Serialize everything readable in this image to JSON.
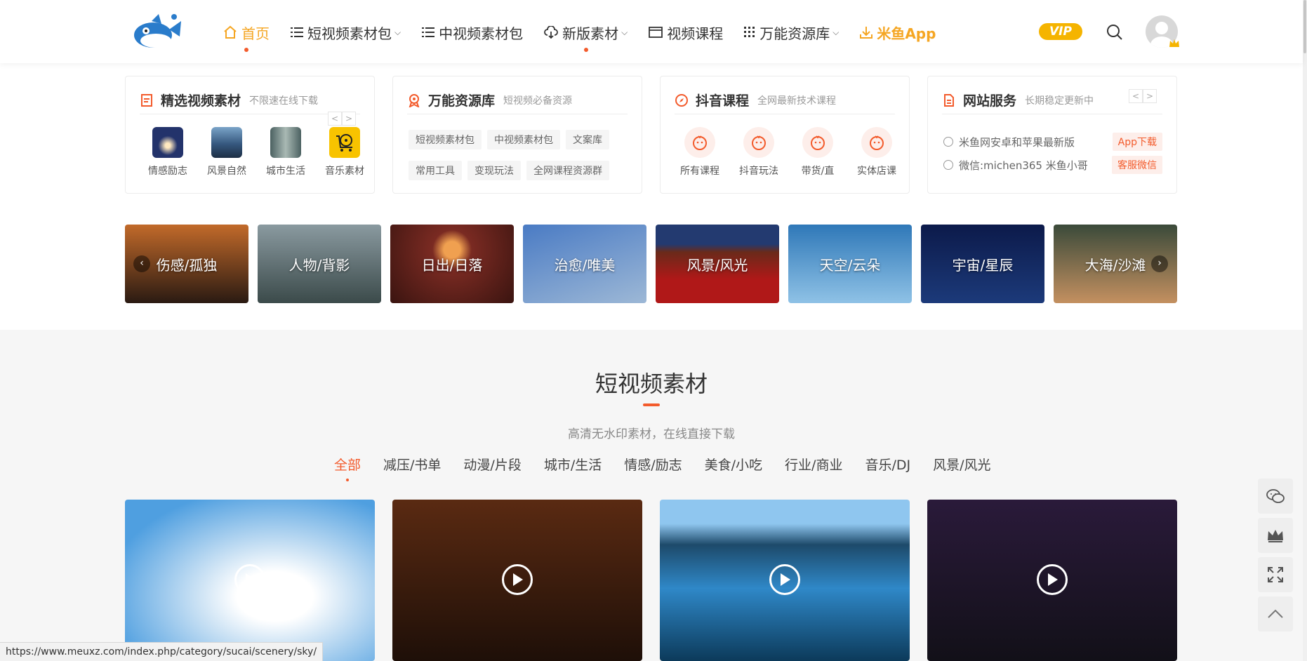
{
  "header": {
    "nav": [
      {
        "label": "首页",
        "icon": "home-icon",
        "active": true
      },
      {
        "label": "短视频素材包",
        "icon": "list-icon",
        "caret": true
      },
      {
        "label": "中视频素材包",
        "icon": "list-icon"
      },
      {
        "label": "新版素材",
        "icon": "cloud-download-icon",
        "caret": true
      },
      {
        "label": "视频课程",
        "icon": "browser-icon"
      },
      {
        "label": "万能资源库",
        "icon": "grid-icon",
        "caret": true
      },
      {
        "label": "米鱼App",
        "icon": "download-icon"
      }
    ],
    "vip_label": "VIP"
  },
  "cards": {
    "featured": {
      "title": "精选视频素材",
      "subtitle": "不限速在线下载",
      "items": [
        {
          "label": "情感励志",
          "color": "#23336b"
        },
        {
          "label": "风景自然",
          "color": "#36587f"
        },
        {
          "label": "城市生活",
          "color": "#6f8c8c"
        },
        {
          "label": "音乐素材",
          "color": "#f8c300"
        }
      ]
    },
    "library": {
      "title": "万能资源库",
      "subtitle": "短视频必备资源",
      "tags": [
        "短视频素材包",
        "中视频素材包",
        "文案库",
        "常用工具",
        "变现玩法",
        "全网课程资源群"
      ]
    },
    "courses": {
      "title": "抖音课程",
      "subtitle": "全网最新技术课程",
      "items": [
        "所有课程",
        "抖音玩法",
        "带货/直",
        "实体店课"
      ]
    },
    "service": {
      "title": "网站服务",
      "subtitle": "长期稳定更新中",
      "rows": [
        {
          "text": "米鱼网安卓和苹果最新版",
          "button": "App下载"
        },
        {
          "text": "微信:michen365 米鱼小哥",
          "button": "客服微信"
        }
      ]
    }
  },
  "banners": [
    {
      "label": "伤感/孤独",
      "c1": "#c26a2a",
      "c2": "#2a1a12"
    },
    {
      "label": "人物/背影",
      "c1": "#8a9aa0",
      "c2": "#3b4a4a"
    },
    {
      "label": "日出/日落",
      "c1": "#7a2a22",
      "c2": "#3a1410"
    },
    {
      "label": "治愈/唯美",
      "c1": "#4a7bc4",
      "c2": "#9db8d6"
    },
    {
      "label": "风景/风光",
      "c1": "#b01818",
      "c2": "#6a2a1a"
    },
    {
      "label": "天空/云朵",
      "c1": "#2f78b8",
      "c2": "#8fc2e6"
    },
    {
      "label": "宇宙/星辰",
      "c1": "#0c1a4a",
      "c2": "#1c3a7a"
    },
    {
      "label": "大海/沙滩",
      "c1": "#3a4a3a",
      "c2": "#c49060"
    }
  ],
  "section": {
    "title": "短视频素材",
    "subtitle": "高清无水印素材，在线直接下载",
    "filters": [
      "全部",
      "减压/书单",
      "动漫/片段",
      "城市/生活",
      "情感/励志",
      "美食/小吃",
      "行业/商业",
      "音乐/DJ",
      "风景/风光"
    ]
  },
  "videos": [
    {
      "c1": "#4f9fe0",
      "c2": "#cfe4f5"
    },
    {
      "c1": "#5a2a12",
      "c2": "#1e0f08"
    },
    {
      "c1": "#2f88c8",
      "c2": "#0c3a5a"
    },
    {
      "c1": "#2a1a3a",
      "c2": "#121018"
    }
  ],
  "status_url": "https://www.meuxz.com/index.php/category/sucai/scenery/sky/"
}
